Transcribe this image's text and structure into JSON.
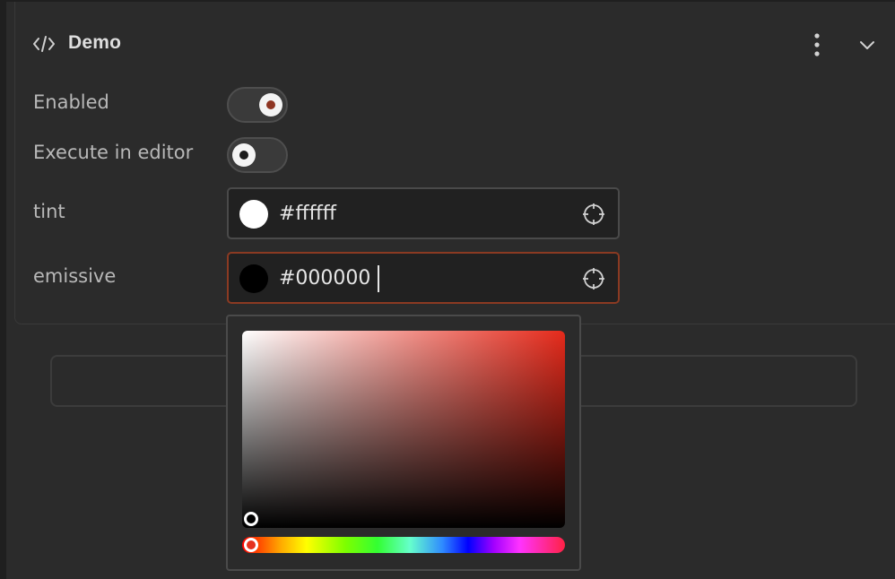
{
  "component": {
    "title": "Demo",
    "icon": "code-icon",
    "menu_icon": "more-vertical-icon",
    "collapse_icon": "chevron-down-icon"
  },
  "fields": {
    "enabled": {
      "label": "Enabled",
      "value": true
    },
    "execute_in_editor": {
      "label": "Execute in editor",
      "value": false
    },
    "tint": {
      "label": "tint",
      "value": "#ffffff",
      "swatch_color": "#ffffff",
      "icon": "eyedropper-icon"
    },
    "emissive": {
      "label": "emissive",
      "value": "#000000",
      "swatch_color": "#000000",
      "icon": "eyedropper-icon"
    }
  },
  "color_picker": {
    "hue_color": "#e52a1b",
    "selected_color": "#000000"
  },
  "theme": {
    "accent": "#8e3522",
    "background": "#2b2b2b",
    "field_background": "#212121"
  }
}
